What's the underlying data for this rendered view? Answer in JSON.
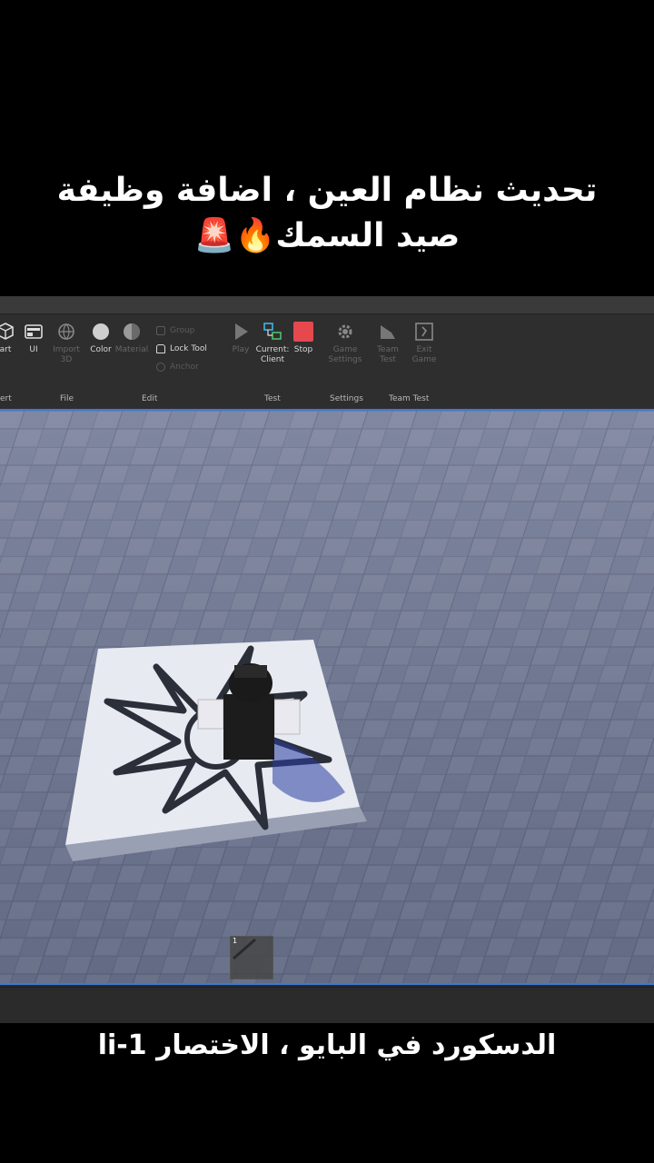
{
  "captions": {
    "top_line1": "تحديث نظام العين ، اضافة وظيفة",
    "top_line2": "صيد السمك🔥🚨",
    "bottom": "الدسكورد في البايو ، الاختصار li-1"
  },
  "ribbon": {
    "tools": [
      {
        "label": "art",
        "name": "part-tool",
        "icon": "cube-icon",
        "dim": false
      },
      {
        "label": "UI",
        "name": "ui-tool",
        "icon": "ui-window-icon",
        "dim": false
      },
      {
        "label": "Import 3D",
        "name": "import-3d-tool",
        "icon": "globe-icon",
        "dim": true
      },
      {
        "label": "Color",
        "name": "color-tool",
        "icon": "color-circle-icon",
        "dim": false
      },
      {
        "label": "Material",
        "name": "material-tool",
        "icon": "material-sphere-icon",
        "dim": true
      },
      {
        "label": "Play",
        "name": "play-tool",
        "icon": "play-icon",
        "dim": true
      },
      {
        "label": "Current: Client",
        "name": "current-client-tool",
        "icon": "client-server-icon",
        "dim": false
      },
      {
        "label": "Stop",
        "name": "stop-tool",
        "icon": "stop-icon",
        "dim": false
      },
      {
        "label": "Game Settings",
        "name": "game-settings-tool",
        "icon": "gear-icon",
        "dim": true
      },
      {
        "label": "Team Test",
        "name": "team-test-tool",
        "icon": "team-test-icon",
        "dim": true
      },
      {
        "label": "Exit Game",
        "name": "exit-game-tool",
        "icon": "exit-icon",
        "dim": true
      }
    ],
    "edit_rows": [
      {
        "label": "Group",
        "dim": true
      },
      {
        "label": "Lock Tool",
        "dim": false
      },
      {
        "label": "Anchor",
        "dim": true
      }
    ],
    "groups": [
      "ert",
      "File",
      "Edit",
      "Test",
      "Settings",
      "Team Test"
    ]
  },
  "hotbar": {
    "slot_number": "1"
  },
  "colors": {
    "ribbon_bg": "#2e2e2e",
    "viewport_accent": "#3a7bd5",
    "stop_red": "#e5484d",
    "floor": "#6e7690",
    "platform": "#e6e8ef",
    "emblem": "#2b2f3a"
  }
}
